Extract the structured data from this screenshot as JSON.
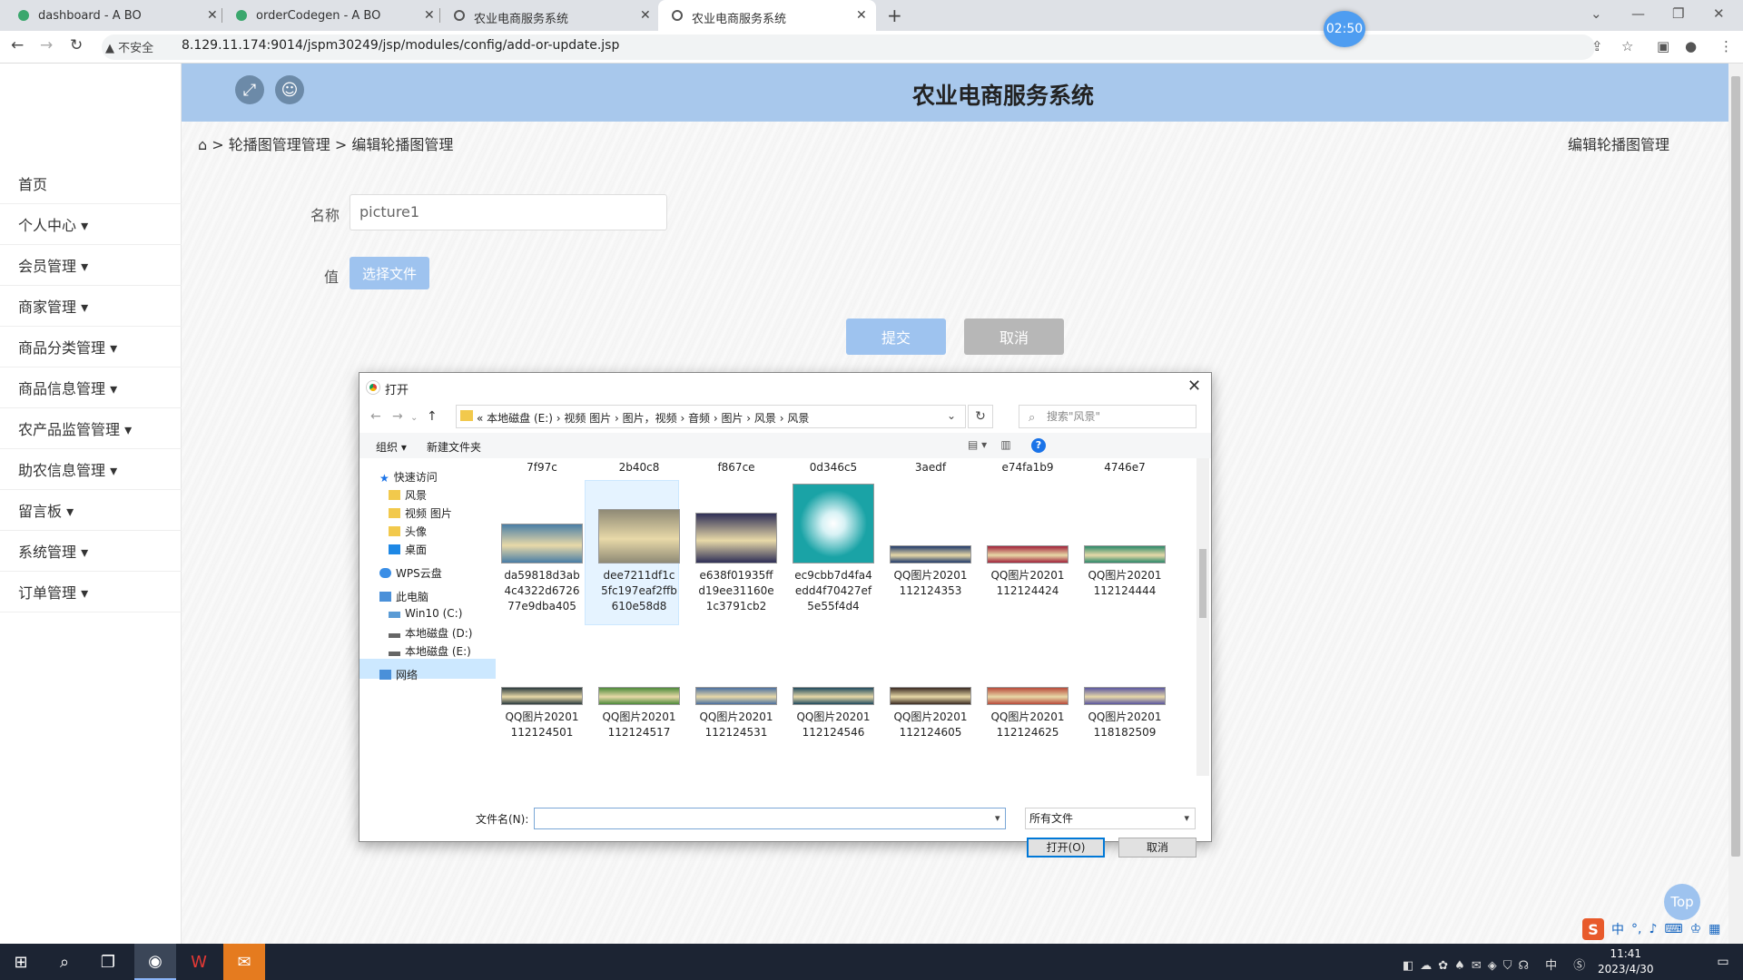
{
  "browser": {
    "tabs": [
      {
        "title": "dashboard - A BO",
        "icon": "green-leaf-icon"
      },
      {
        "title": "orderCodegen - A BO",
        "icon": "green-leaf-icon"
      },
      {
        "title": "农业电商服务系统",
        "icon": "globe-icon"
      },
      {
        "title": "农业电商服务系统",
        "icon": "globe-icon"
      }
    ],
    "timer": "02:50",
    "insecure_label": "不安全",
    "url": "8.129.11.174:9014/jspm30249/jsp/modules/config/add-or-update.jsp"
  },
  "sidebar": {
    "items": [
      {
        "label": "首页"
      },
      {
        "label": "个人中心 ▾"
      },
      {
        "label": "会员管理 ▾"
      },
      {
        "label": "商家管理 ▾"
      },
      {
        "label": "商品分类管理 ▾"
      },
      {
        "label": "商品信息管理 ▾"
      },
      {
        "label": "农产品监管管理 ▾"
      },
      {
        "label": "助农信息管理 ▾"
      },
      {
        "label": "留言板 ▾"
      },
      {
        "label": "系统管理 ▾"
      },
      {
        "label": "订单管理 ▾"
      }
    ]
  },
  "header": {
    "title": "农业电商服务系统"
  },
  "breadcrumb": {
    "home_sep": ">",
    "level1": "轮播图管理管理",
    "sep": ">",
    "level2": "编辑轮播图管理",
    "right": "编辑轮播图管理"
  },
  "form": {
    "name_label": "名称",
    "name_value": "picture1",
    "value_label": "值",
    "choose_file": "选择文件",
    "submit": "提交",
    "cancel": "取消"
  },
  "top_button": "Top",
  "dialog": {
    "title": "打开",
    "path": "« 本地磁盘 (E:) › 视频 图片 › 图片，视频 › 音频 › 图片 › 风景 › 风景",
    "search_placeholder": "搜索\"风景\"",
    "organize": "组织 ▾",
    "new_folder": "新建文件夹",
    "nav": {
      "quick_access": "快速访问",
      "folders": [
        "风景",
        "视频 图片",
        "头像"
      ],
      "desktop": "桌面",
      "wps": "WPS云盘",
      "this_pc": "此电脑",
      "drives": [
        "Win10 (C:)",
        "本地磁盘 (D:)",
        "本地磁盘 (E:)"
      ],
      "network": "网络"
    },
    "partial_row": [
      "7f97c",
      "2b40c8",
      "f867ce",
      "0d346c5",
      "3aedf",
      "e74fa1b9",
      "4746e7"
    ],
    "row1": [
      {
        "name": "da59818d3ab4c4322d672677e9dba405",
        "color": "#4a7ea6"
      },
      {
        "name": "dee7211df1c5fc197eaf2ffb610e58d8",
        "color": "#8f8a76"
      },
      {
        "name": "e638f01935ffd19ee31160e1c3791cb2",
        "color": "#2f2f57"
      },
      {
        "name": "ec9cbb7d4fa4edd4f70427ef5e55f4d4",
        "color": "#1aa3a6"
      },
      {
        "name": "QQ图片20201112124353",
        "color": "#203a6b"
      },
      {
        "name": "QQ图片20201112124424",
        "color": "#a3233a"
      },
      {
        "name": "QQ图片20201112124444",
        "color": "#2c8a6a"
      }
    ],
    "row2": [
      {
        "name": "QQ图片20201112124501",
        "color": "#2a3a3e"
      },
      {
        "name": "QQ图片20201112124517",
        "color": "#4c8a3a"
      },
      {
        "name": "QQ图片20201112124531",
        "color": "#4a6fa0"
      },
      {
        "name": "QQ图片20201112124546",
        "color": "#1f4a5e"
      },
      {
        "name": "QQ图片20201112124605",
        "color": "#3a2a22"
      },
      {
        "name": "QQ图片20201112124625",
        "color": "#b84a3a"
      },
      {
        "name": "QQ图片20201118182509",
        "color": "#5a56a0"
      }
    ],
    "filename_label": "文件名(N):",
    "filename_value": "",
    "filetype": "所有文件",
    "open": "打开(O)",
    "cancel": "取消"
  },
  "taskbar": {
    "time": "11:41",
    "date": "2023/4/30"
  },
  "ime": {
    "logo": "S",
    "lang": "中"
  }
}
